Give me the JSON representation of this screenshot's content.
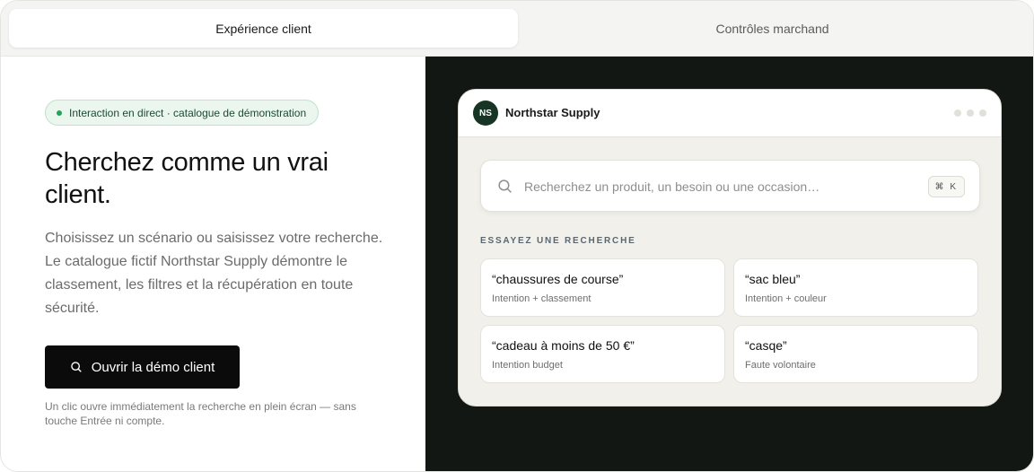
{
  "tabs": [
    {
      "label": "Expérience client",
      "active": true
    },
    {
      "label": "Contrôles marchand",
      "active": false
    }
  ],
  "left": {
    "badge": "Interaction en direct · catalogue de démonstration",
    "headline": "Cherchez comme un vrai client.",
    "lead": "Choisissez un scénario ou saisissez votre recherche. Le catalogue fictif Northstar Supply démontre le classement, les filtres et la récupération en toute sécurité.",
    "cta_label": "Ouvrir la démo client",
    "note": "Un clic ouvre immédiatement la recherche en plein écran — sans touche Entrée ni compte."
  },
  "demo": {
    "logo_initials": "NS",
    "brand": "Northstar Supply",
    "search_placeholder": "Recherchez un produit, un besoin ou une occasion…",
    "shortcut": "⌘ K",
    "section_title": "ESSAYEZ UNE RECHERCHE",
    "suggestions": [
      {
        "query": "“chaussures de course”",
        "desc": "Intention + classement"
      },
      {
        "query": "“sac bleu”",
        "desc": "Intention + couleur"
      },
      {
        "query": "“cadeau à moins de 50 €”",
        "desc": "Intention budget"
      },
      {
        "query": "“casqe”",
        "desc": "Faute volontaire"
      }
    ]
  },
  "colors": {
    "accent_dark": "#121713",
    "brand_green": "#173525",
    "live_green": "#22a559"
  }
}
